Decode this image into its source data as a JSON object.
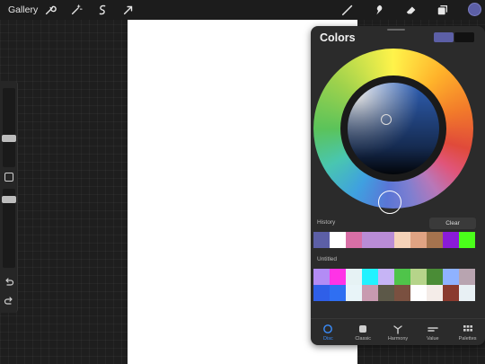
{
  "topbar": {
    "gallery_label": "Gallery",
    "left_icons": [
      "wrench-icon",
      "magic-wand-icon",
      "selection-icon",
      "transform-arrow-icon"
    ],
    "right_icons": [
      "brush-icon",
      "smudge-icon",
      "eraser-icon",
      "layers-icon"
    ],
    "current_color": "#5c5fa6"
  },
  "panel": {
    "title": "Colors",
    "primary_color": "#5c5fa6",
    "secondary_color": "#111111",
    "history_label": "History",
    "clear_label": "Clear",
    "history": [
      "#5c5fa6",
      "#ffffff",
      "#d86fa6",
      "#b98cd6",
      "#b98cd6",
      "#f5d2b8",
      "#e0a383",
      "#a5734e",
      "#8a1bd8",
      "#4aff1a"
    ],
    "palette_label": "Untitled",
    "palette_row1": [
      "#b38cf5",
      "#ff33e6",
      "#e6f2f4",
      "#22f2ff",
      "#c6b4f5",
      "#4fc44a",
      "#b6d48a",
      "#4a8c36",
      "#8fb2ff",
      "#b8a4b0"
    ],
    "palette_row2": [
      "#2f5fe8",
      "#2f6ff2",
      "#e8f4f8",
      "#c89ab0",
      "#5c5848",
      "#7a5040",
      "#ffffff",
      "#f4ece8",
      "#8a3a2e",
      "#e8f0f4"
    ],
    "tabs": [
      {
        "label": "Disc",
        "icon": "disc-icon",
        "active": true
      },
      {
        "label": "Classic",
        "icon": "classic-square-icon",
        "active": false
      },
      {
        "label": "Harmony",
        "icon": "harmony-icon",
        "active": false
      },
      {
        "label": "Value",
        "icon": "value-sliders-icon",
        "active": false
      },
      {
        "label": "Palettes",
        "icon": "palettes-grid-icon",
        "active": false
      }
    ]
  }
}
